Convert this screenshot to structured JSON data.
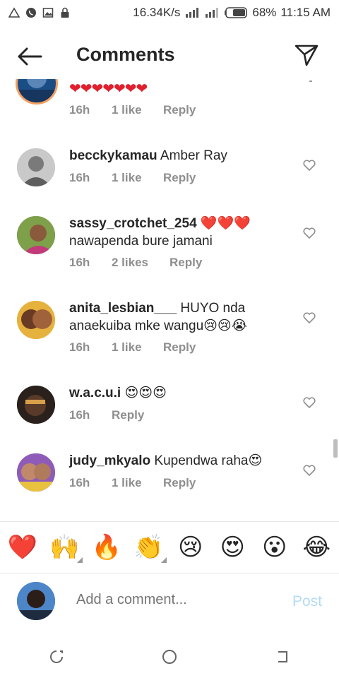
{
  "status_bar": {
    "speed": "16.34K/s",
    "battery": "68%",
    "time": "11:15 AM"
  },
  "header": {
    "title": "Comments",
    "back_icon": "arrow-left-icon",
    "send_icon": "paper-plane-icon"
  },
  "comments": [
    {
      "username": "",
      "text": "❤❤❤❤❤❤❤",
      "time": "16h",
      "likes": "1 like",
      "reply": "Reply"
    },
    {
      "username": "becckykamau",
      "text": "Amber Ray",
      "time": "16h",
      "likes": "1 like",
      "reply": "Reply"
    },
    {
      "username": "sassy_crotchet_254",
      "text": "❤️❤️❤️",
      "text2": "nawapenda bure jamani",
      "time": "16h",
      "likes": "2 likes",
      "reply": "Reply"
    },
    {
      "username": "anita_lesbian___",
      "text": "HUYO nda",
      "text2": "anaekuiba mke wangu😢😢😭",
      "time": "16h",
      "likes": "1 like",
      "reply": "Reply"
    },
    {
      "username": "w.a.c.u.i",
      "text": "😍😍😍",
      "time": "16h",
      "likes": "",
      "reply": "Reply"
    },
    {
      "username": "judy_mkyalo",
      "text": "Kupendwa raha😍",
      "time": "16h",
      "likes": "1 like",
      "reply": "Reply"
    }
  ],
  "emoji_bar": [
    "❤️",
    "🙌",
    "🔥",
    "👏",
    "😢",
    "😍",
    "😮",
    "😂"
  ],
  "compose": {
    "placeholder": "Add a comment...",
    "post_label": "Post"
  },
  "colors": {
    "post_disabled": "#b3dbf7",
    "meta_gray": "#8e8e8e",
    "heart_red": "#e0202e"
  }
}
